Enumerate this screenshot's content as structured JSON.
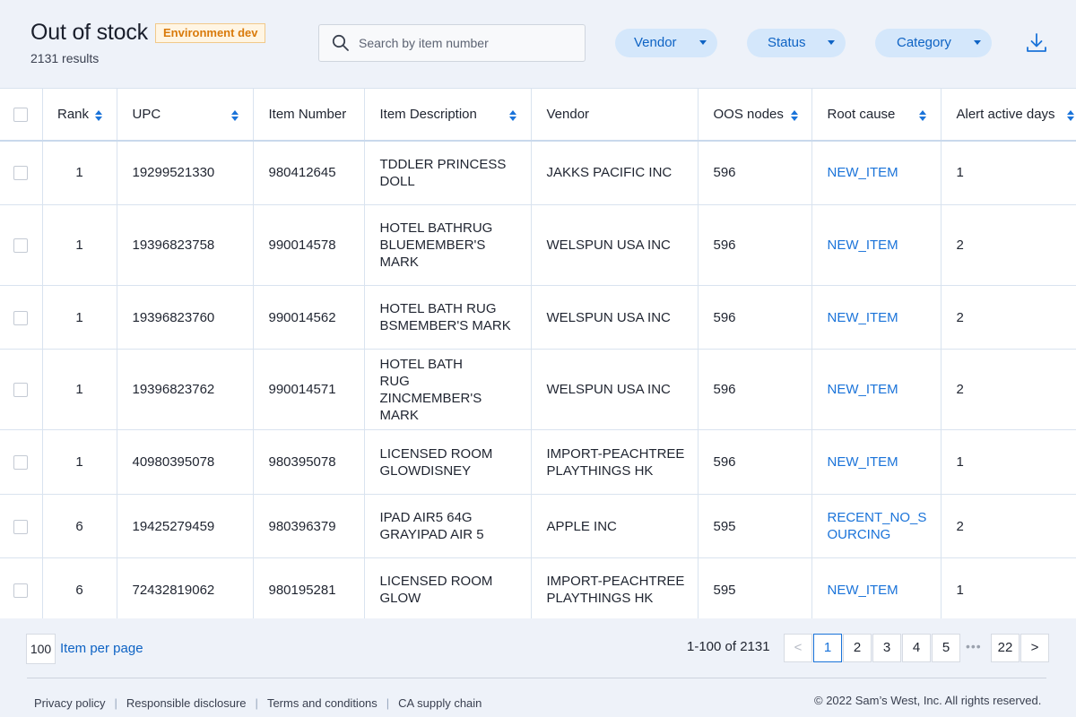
{
  "header": {
    "title": "Out of stock",
    "env_badge": "Environment dev",
    "results": "2131 results",
    "search_placeholder": "Search by item number",
    "filters": [
      {
        "label": "Vendor"
      },
      {
        "label": "Status"
      },
      {
        "label": "Category"
      }
    ]
  },
  "table": {
    "columns": [
      "Rank",
      "UPC",
      "Item Number",
      "Item Description",
      "Vendor",
      "OOS nodes",
      "Root cause",
      "Alert active days"
    ],
    "rows": [
      {
        "rank": "1",
        "upc": "19299521330",
        "item_number": "980412645",
        "description": "TDDLER PRINCESS DOLL",
        "vendor": "JAKKS PACIFIC INC",
        "oos_nodes": "596",
        "root_cause": "NEW_ITEM",
        "alert_days": "1"
      },
      {
        "rank": "1",
        "upc": "19396823758",
        "item_number": "990014578",
        "description": "HOTEL BATHRUG BLUEMEMBER'S MARK",
        "vendor": "WELSPUN USA INC",
        "oos_nodes": "596",
        "root_cause": "NEW_ITEM",
        "alert_days": "2"
      },
      {
        "rank": "1",
        "upc": "19396823760",
        "item_number": "990014562",
        "description": "HOTEL BATH RUG BSMEMBER'S MARK",
        "vendor": "WELSPUN USA INC",
        "oos_nodes": "596",
        "root_cause": "NEW_ITEM",
        "alert_days": "2"
      },
      {
        "rank": "1",
        "upc": "19396823762",
        "item_number": "990014571",
        "description": "HOTEL BATH RUG ZINCMEMBER'S MARK",
        "vendor": "WELSPUN USA INC",
        "oos_nodes": "596",
        "root_cause": "NEW_ITEM",
        "alert_days": "2"
      },
      {
        "rank": "1",
        "upc": "40980395078",
        "item_number": "980395078",
        "description": "LICENSED ROOM GLOWDISNEY",
        "vendor": "IMPORT-PEACHTREE PLAYTHINGS HK",
        "oos_nodes": "596",
        "root_cause": "NEW_ITEM",
        "alert_days": "1"
      },
      {
        "rank": "6",
        "upc": "19425279459",
        "item_number": "980396379",
        "description": "IPAD AIR5 64G GRAYIPAD AIR 5",
        "vendor": "APPLE INC",
        "oos_nodes": "595",
        "root_cause": "RECENT_NO_SOURCING",
        "alert_days": "2"
      },
      {
        "rank": "6",
        "upc": "72432819062",
        "item_number": "980195281",
        "description": "LICENSED ROOM GLOW",
        "vendor": "IMPORT-PEACHTREE PLAYTHINGS HK",
        "oos_nodes": "595",
        "root_cause": "NEW_ITEM",
        "alert_days": "1"
      }
    ]
  },
  "footer": {
    "per_page_value": "100",
    "per_page_label": "Item per page",
    "range": "1-100 of 2131",
    "prev": "<",
    "next": ">",
    "pages": [
      "1",
      "2",
      "3",
      "4",
      "5"
    ],
    "ellipsis": "•••",
    "last_page": "22",
    "links": [
      "Privacy policy",
      "Responsible disclosure",
      "Terms and conditions",
      "CA supply chain"
    ],
    "copyright": "© 2022 Sam’s West, Inc. All rights reserved."
  },
  "colors": {
    "accent": "#1a73d9",
    "pill_bg": "#d4e7fb",
    "badge_text": "#d97a0b",
    "page_bg": "#eef2f9"
  },
  "icons": {
    "search": "search-icon",
    "download": "download-icon",
    "sort": "sort-icon",
    "caret": "chevron-down-icon"
  }
}
